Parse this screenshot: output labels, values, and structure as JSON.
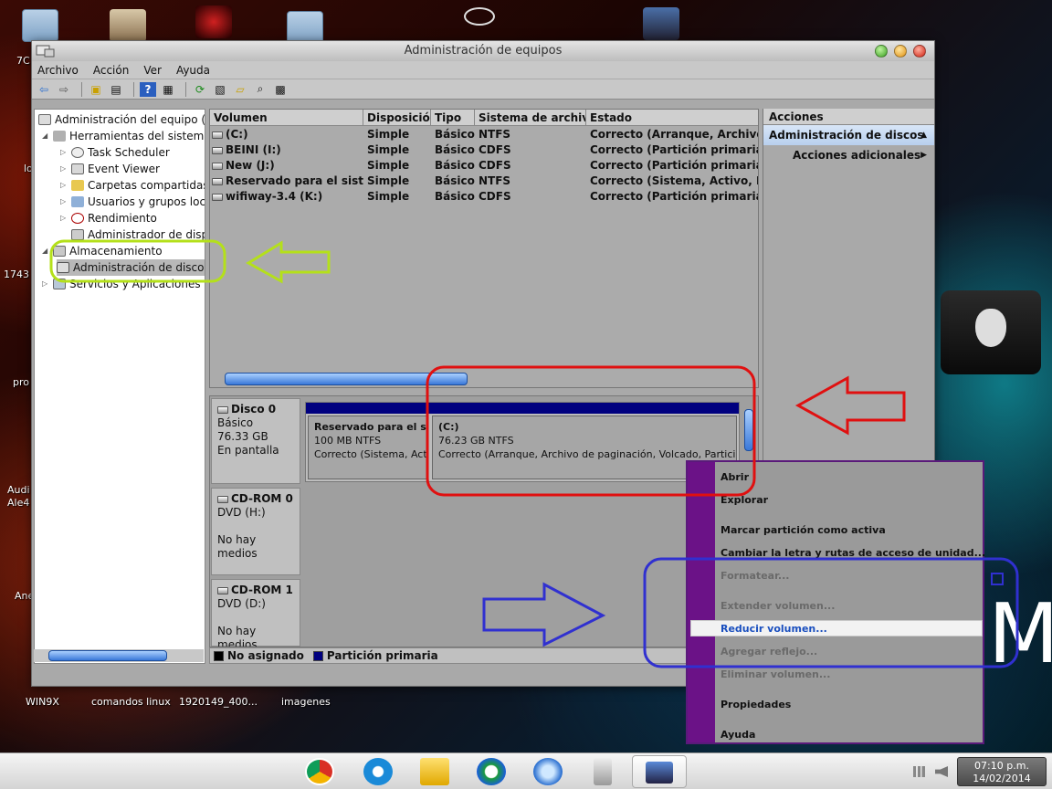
{
  "window": {
    "title": "Administración de equipos",
    "menu": [
      "Archivo",
      "Acción",
      "Ver",
      "Ayuda"
    ]
  },
  "desktop": {
    "labels": [
      "7C",
      "lo",
      "1743",
      "pro",
      "Audi",
      "Ale4",
      "Ane",
      "WIN9X",
      "comandos linux",
      "1920149_400...",
      "imagenes"
    ],
    "right_letter": "M"
  },
  "tree": {
    "root": "Administración del equipo (loc",
    "tools": "Herramientas del sistema",
    "task_scheduler": "Task Scheduler",
    "event_viewer": "Event Viewer",
    "shared_folders": "Carpetas compartidas",
    "users_groups": "Usuarios y grupos locale",
    "performance": "Rendimiento",
    "device_manager": "Administrador de dispo",
    "storage": "Almacenamiento",
    "disk_mgmt": "Administración de disco",
    "services": "Servicios y Aplicaciones"
  },
  "volumes": {
    "headers": {
      "volume": "Volumen",
      "layout": "Disposición",
      "type": "Tipo",
      "fs": "Sistema de archivos",
      "status": "Estado"
    },
    "rows": [
      {
        "volume": "(C:)",
        "layout": "Simple",
        "type": "Básico",
        "fs": "NTFS",
        "status": "Correcto (Arranque, Archivo de p"
      },
      {
        "volume": "BEINI (I:)",
        "layout": "Simple",
        "type": "Básico",
        "fs": "CDFS",
        "status": "Correcto (Partición primaria)"
      },
      {
        "volume": "New (J:)",
        "layout": "Simple",
        "type": "Básico",
        "fs": "CDFS",
        "status": "Correcto (Partición primaria)"
      },
      {
        "volume": "Reservado para el sistema",
        "layout": "Simple",
        "type": "Básico",
        "fs": "NTFS",
        "status": "Correcto (Sistema, Activo, Partici"
      },
      {
        "volume": "wifiway-3.4 (K:)",
        "layout": "Simple",
        "type": "Básico",
        "fs": "CDFS",
        "status": "Correcto (Partición primaria)"
      }
    ]
  },
  "disks": {
    "disk0": {
      "name": "Disco 0",
      "type": "Básico",
      "size": "76.33 GB",
      "state": "En pantalla",
      "part1": {
        "name": "Reservado para el siste",
        "size": "100 MB NTFS",
        "status": "Correcto (Sistema, Activ"
      },
      "part2": {
        "name": "(C:)",
        "size": "76.23 GB NTFS",
        "status": "Correcto (Arranque, Archivo de paginación, Volcado, Partició"
      }
    },
    "cdrom0": {
      "name": "CD-ROM 0",
      "drive": "DVD (H:)",
      "media": "No hay medios"
    },
    "cdrom1": {
      "name": "CD-ROM 1",
      "drive": "DVD (D:)",
      "media": "No hay medios"
    }
  },
  "legend": {
    "unallocated": "No asignado",
    "primary": "Partición primaria"
  },
  "actions": {
    "header": "Acciones",
    "selected": "Administración de discos",
    "more": "Acciones adicionales"
  },
  "context_menu": {
    "open": "Abrir",
    "explore": "Explorar",
    "mark_active": "Marcar partición como activa",
    "change_letter": "Cambiar la letra y rutas de acceso de unidad...",
    "format": "Formatear...",
    "extend": "Extender volumen...",
    "shrink": "Reducir volumen...",
    "mirror": "Agregar reflejo...",
    "delete": "Eliminar volumen...",
    "properties": "Propiedades",
    "help": "Ayuda"
  },
  "clock": {
    "time": "07:10 p.m.",
    "date": "14/02/2014"
  },
  "colors": {
    "primary_partition": "#00007f",
    "annotation_green": "#b4e01a",
    "annotation_red": "#e01010",
    "annotation_blue": "#3030d0",
    "menu_gutter": "#6b1287"
  }
}
